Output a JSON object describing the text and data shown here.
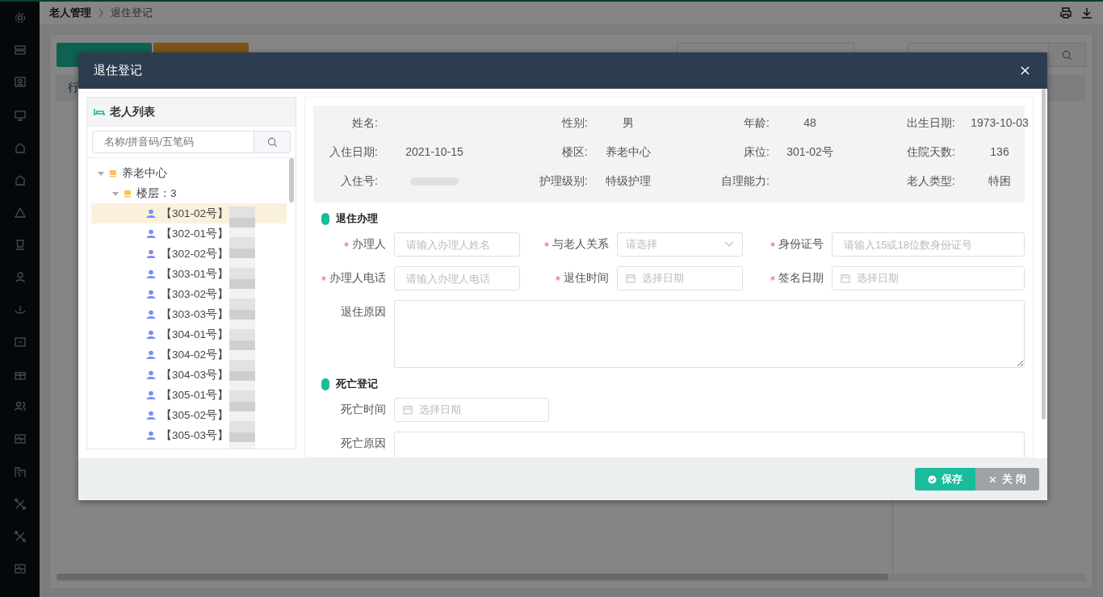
{
  "breadcrumb": [
    {
      "label": "老人管理"
    },
    {
      "label": "退住登记"
    }
  ],
  "table": {
    "column_1": "行"
  },
  "dialog": {
    "title": "退住登记",
    "elder_list": {
      "title": "老人列表",
      "search_placeholder": "名称/拼音码/五笔码",
      "tree": [
        {
          "label": "养老中心",
          "expanded": true,
          "children": [
            {
              "label": "楼层：3",
              "expanded": true,
              "children": [
                {
                  "label": "【301-02号】",
                  "selected": true
                },
                {
                  "label": "【302-01号】",
                  "selected": false
                },
                {
                  "label": "【302-02号】",
                  "selected": false
                },
                {
                  "label": "【303-01号】",
                  "selected": false
                },
                {
                  "label": "【303-02号】",
                  "selected": false
                },
                {
                  "label": "【303-03号】",
                  "selected": false
                },
                {
                  "label": "【304-01号】",
                  "selected": false
                },
                {
                  "label": "【304-02号】",
                  "selected": false
                },
                {
                  "label": "【304-03号】",
                  "selected": false
                },
                {
                  "label": "【305-01号】",
                  "selected": false
                },
                {
                  "label": "【305-02号】",
                  "selected": false
                },
                {
                  "label": "【305-03号】",
                  "selected": false
                }
              ]
            }
          ]
        }
      ]
    },
    "info": [
      {
        "label": "姓名:",
        "redacted": false
      },
      {
        "label": "性别:",
        "value": "男",
        "redacted": false
      },
      {
        "label": "年龄:",
        "value": "48",
        "redacted": false
      },
      {
        "label": "出生日期:",
        "value": "1973-10-03",
        "redacted": false
      },
      {
        "label": "入住日期:",
        "value": "2021-10-15",
        "redacted": false
      },
      {
        "label": "楼区:",
        "value": "养老中心",
        "redacted": false
      },
      {
        "label": "床位:",
        "value": "301-02号",
        "redacted": false
      },
      {
        "label": "住院天数:",
        "value": "136",
        "redacted": false
      },
      {
        "label": "入住号:",
        "redacted": true
      },
      {
        "label": "护理级别:",
        "value": "特级护理",
        "redacted": false
      },
      {
        "label": "自理能力:",
        "redacted": false
      },
      {
        "label": "老人类型:",
        "value": "特困",
        "redacted": false
      }
    ],
    "sections": [
      {
        "title": "退住办理",
        "kind": "wide",
        "fields": [
          {
            "label": "办理人",
            "required": true,
            "kind": "text",
            "placeholder": "请输入办理人姓名"
          },
          {
            "label": "与老人关系",
            "required": true,
            "kind": "select",
            "placeholder": "请选择"
          },
          {
            "label": "身份证号",
            "required": true,
            "kind": "text",
            "placeholder": "请输入15或18位数身份证号"
          },
          {
            "label": "办理人电话",
            "required": true,
            "kind": "text",
            "placeholder": "请输入办理人电话"
          },
          {
            "label": "退住时间",
            "required": true,
            "kind": "date",
            "placeholder": "选择日期"
          },
          {
            "label": "签名日期",
            "required": true,
            "kind": "date",
            "placeholder": "选择日期"
          },
          {
            "label": "退住原因",
            "required": false,
            "kind": "textarea"
          }
        ]
      },
      {
        "title": "死亡登记",
        "kind": "narrow",
        "fields": [
          {
            "label": "死亡时间",
            "required": false,
            "kind": "date",
            "placeholder": "选择日期"
          },
          {
            "label": "死亡原因",
            "required": false,
            "kind": "textarea"
          }
        ]
      }
    ],
    "buttons": [
      {
        "label": "保存",
        "kind": "save"
      },
      {
        "label": "关 闭",
        "kind": "close"
      }
    ]
  }
}
